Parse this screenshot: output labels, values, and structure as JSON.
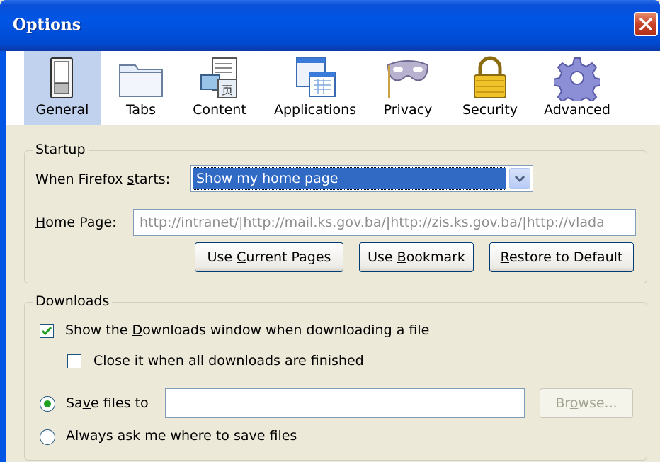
{
  "window": {
    "title": "Options"
  },
  "panes": [
    {
      "label": "General",
      "icon": "general-switch-icon",
      "selected": true
    },
    {
      "label": "Tabs",
      "icon": "tabs-folder-icon"
    },
    {
      "label": "Content",
      "icon": "content-document-icon"
    },
    {
      "label": "Applications",
      "icon": "applications-window-icon"
    },
    {
      "label": "Privacy",
      "icon": "privacy-mask-icon"
    },
    {
      "label": "Security",
      "icon": "security-lock-icon"
    },
    {
      "label": "Advanced",
      "icon": "advanced-gear-icon"
    }
  ],
  "startup": {
    "legend": "Startup",
    "when_label_pre": "When Firefox ",
    "when_label_key": "s",
    "when_label_post": "tarts:",
    "when_value": "Show my home page",
    "home_label_key": "H",
    "home_label_post": "ome Page:",
    "home_value": "http://intranet/|http://mail.ks.gov.ba/|http://zis.ks.gov.ba/|http://vlada",
    "btn_current_pre": "Use ",
    "btn_current_key": "C",
    "btn_current_post": "urrent Pages",
    "btn_bookmark_pre": "Use ",
    "btn_bookmark_key": "B",
    "btn_bookmark_post": "ookmark",
    "btn_restore_key": "R",
    "btn_restore_post": "estore to Default"
  },
  "downloads": {
    "legend": "Downloads",
    "show_pre": "Show the ",
    "show_key": "D",
    "show_post": "ownloads window when downloading a file",
    "show_checked": true,
    "close_pre": "Close it ",
    "close_key": "w",
    "close_post": "hen all downloads are finished",
    "close_checked": false,
    "save_pre": "Sa",
    "save_key": "v",
    "save_post": "e files to",
    "save_selected": true,
    "save_path": "",
    "browse_pre": "Br",
    "browse_key": "o",
    "browse_post": "wse...",
    "ask_key": "A",
    "ask_post": "lways ask me where to save files",
    "ask_selected": false
  },
  "colors": {
    "titlebar": "#0055e5",
    "selected_pane": "#c1d2ee",
    "dialog_bg": "#ece9d8",
    "check_green": "#21a121"
  }
}
